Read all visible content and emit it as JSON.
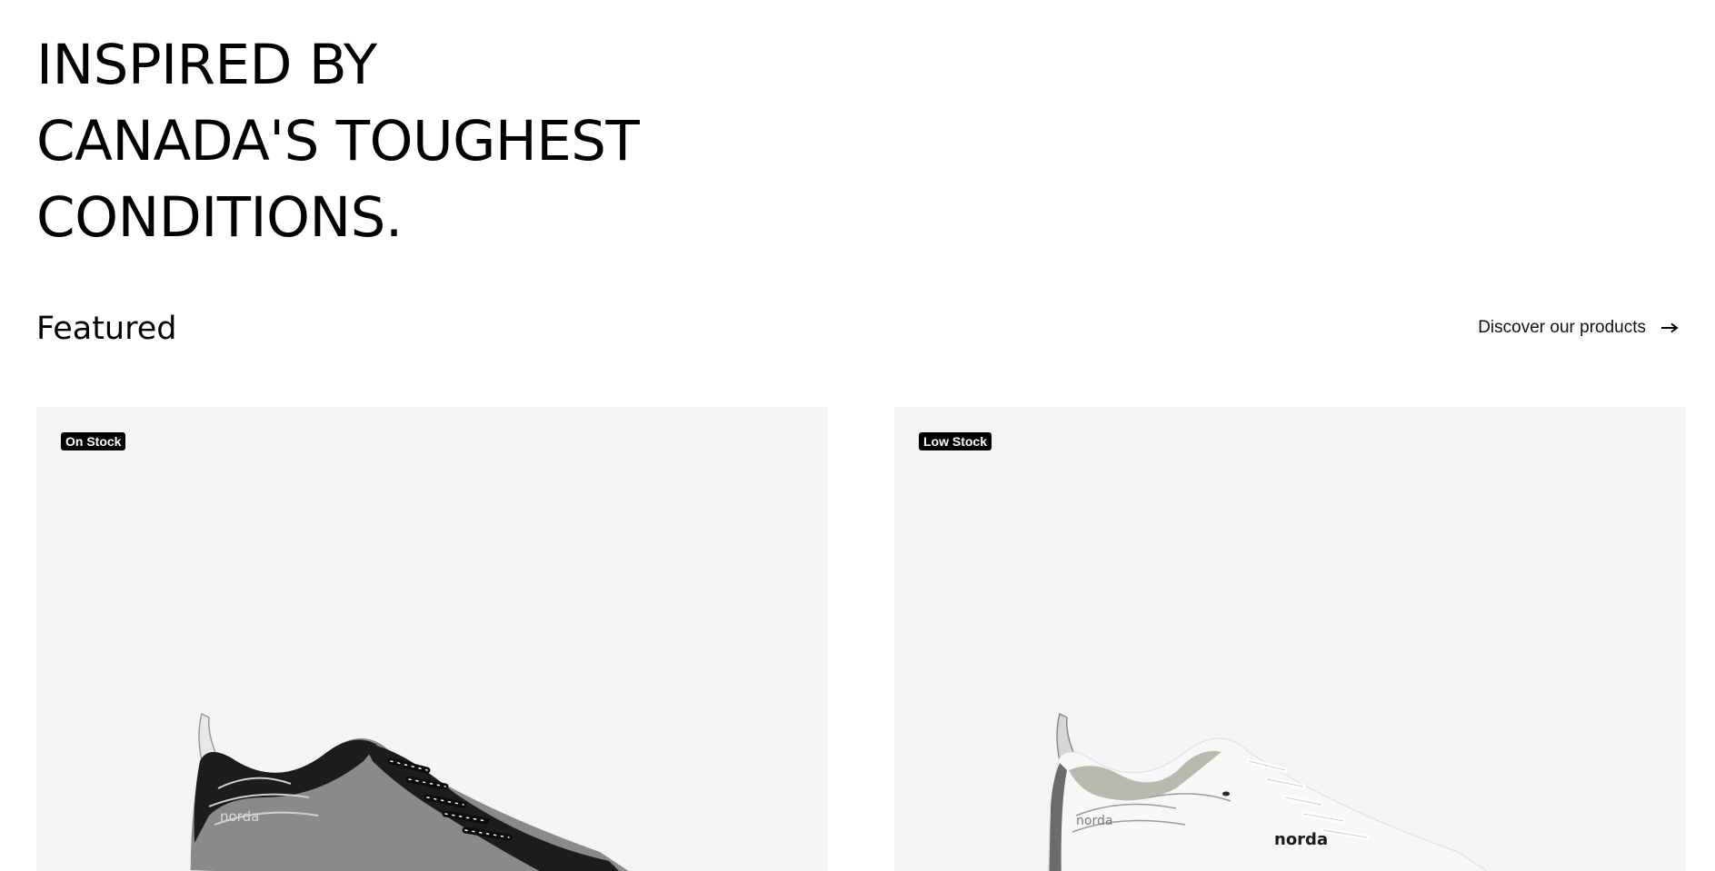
{
  "hero": {
    "lines": [
      "INSPIRED BY",
      "CANADA'S TOUGHEST",
      "CONDITIONS."
    ]
  },
  "featured": {
    "heading": "Featured",
    "link_label": "Discover our products",
    "link_icon": "arrow-right-icon"
  },
  "products": [
    {
      "badge": "On Stock",
      "image": "dark-grey-trail-shoe",
      "brand_mark": "norda",
      "colors": {
        "upper": "#8a8a8a",
        "accent": "#1c1c1c"
      }
    },
    {
      "badge": "Low Stock",
      "image": "white-trail-shoe",
      "brand_mark": "norda",
      "colors": {
        "upper": "#f7f7f7",
        "accent": "#6b6b6b"
      }
    }
  ],
  "colors": {
    "background": "#ffffff",
    "card_background": "#f4f4f4",
    "badge_background": "#000000",
    "badge_text": "#ffffff"
  }
}
